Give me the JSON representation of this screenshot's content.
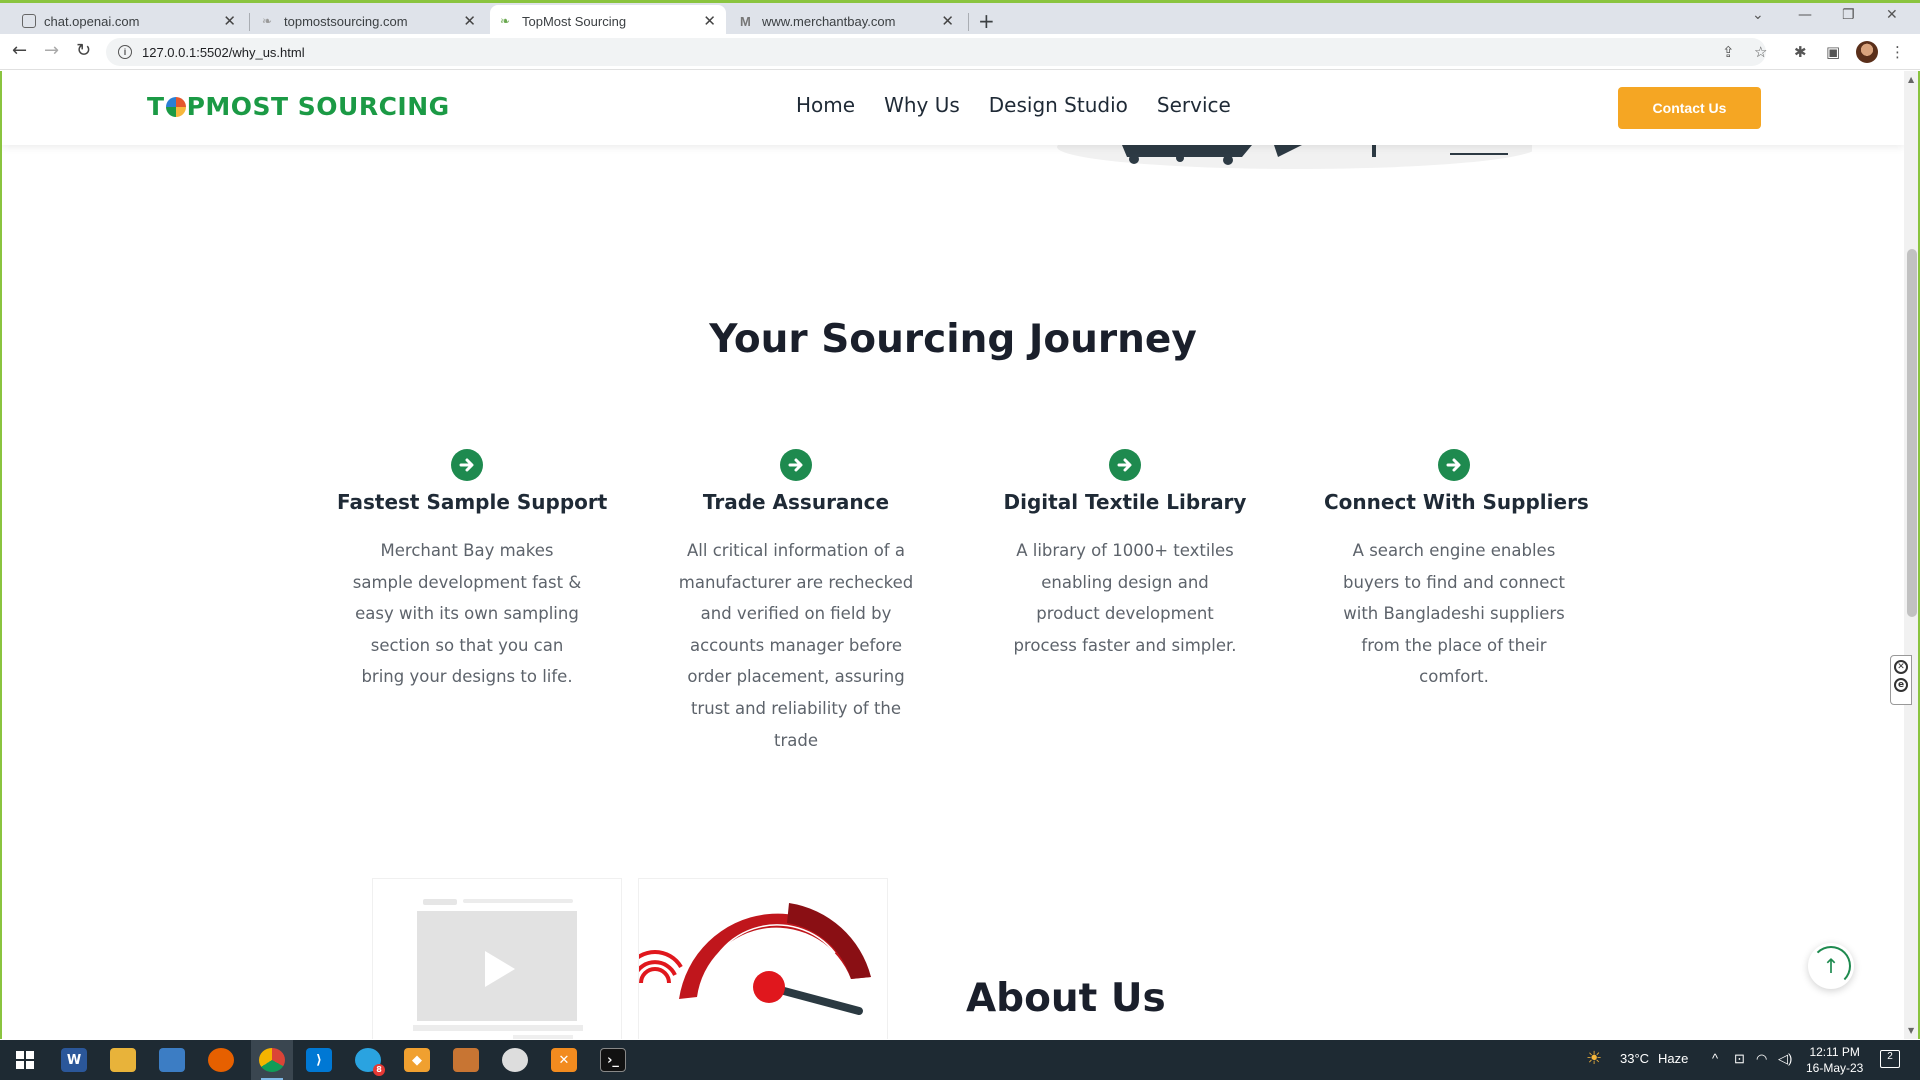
{
  "browser": {
    "tabs": [
      {
        "title": "chat.openai.com",
        "active": false
      },
      {
        "title": "topmostsourcing.com",
        "active": false
      },
      {
        "title": "TopMost Sourcing",
        "active": true
      },
      {
        "title": "www.merchantbay.com",
        "active": false
      }
    ],
    "url": "127.0.0.1:5502/why_us.html"
  },
  "site": {
    "logo_text_left": "T",
    "logo_text_right": "PMOST SOURCING",
    "nav": [
      "Home",
      "Why Us",
      "Design Studio",
      "Service"
    ],
    "contact_label": "Contact Us",
    "brand_colors": {
      "green": "#1e8a4f",
      "orange": "#f5a623"
    }
  },
  "journey": {
    "title": "Your Sourcing Journey",
    "features": [
      {
        "title": "Fastest Sample Support",
        "text": "Merchant Bay makes sample development fast & easy with its own sampling section so that you can bring your designs to life.",
        "icon": "arrow-right-circle-icon"
      },
      {
        "title": "Trade Assurance",
        "text": "All critical information of a manufacturer are rechecked and verified on field by accounts manager before order placement, assuring trust and reliability of the trade",
        "icon": "arrow-right-circle-icon"
      },
      {
        "title": "Digital Textile Library",
        "text": "A library of 1000+ textiles enabling design and product development process faster and simpler.",
        "icon": "arrow-right-circle-icon"
      },
      {
        "title": "Connect With Suppliers",
        "text": "A search engine enables buyers to find and connect with Bangladeshi suppliers from the place of their comfort.",
        "icon": "arrow-right-circle-icon"
      }
    ]
  },
  "about": {
    "title": "About Us"
  },
  "back_to_top": "↑",
  "taskbar": {
    "weather_temp": "33°C",
    "weather_text": "Haze",
    "time": "12:11 PM",
    "date": "16-May-23",
    "notification_count": "2",
    "badge_count": "8"
  }
}
